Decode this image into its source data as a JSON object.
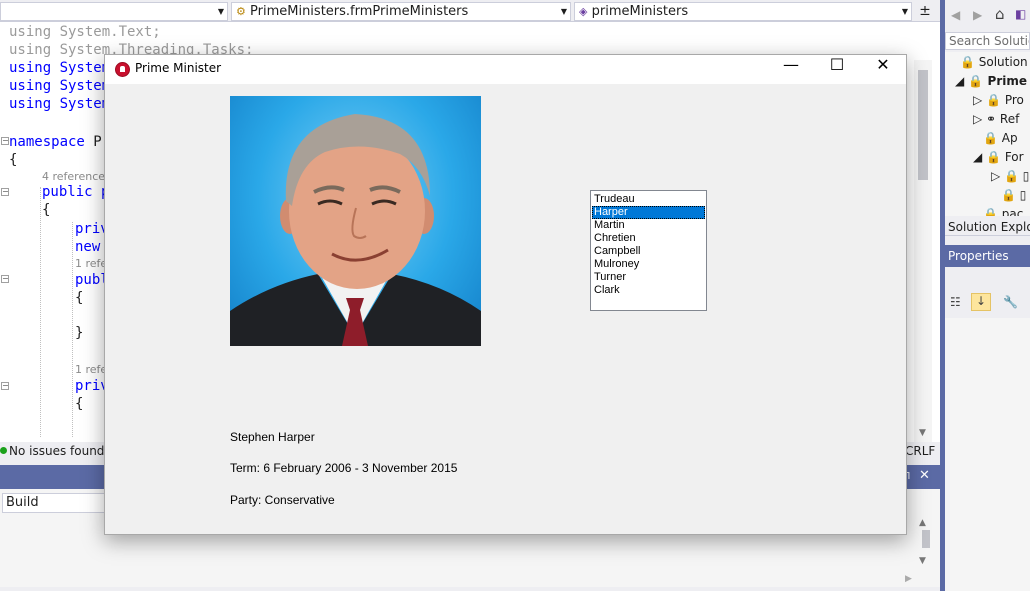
{
  "nav": {
    "project_combo": "PrimeMinisters.frmPrimeMinisters",
    "member_combo": "primeMinisters"
  },
  "code": {
    "lines": [
      "using System.Text;",
      "using System.Threading.Tasks;",
      "using System",
      "using System",
      "using System"
    ],
    "namespace_kw": "namespace",
    "namespace_name": "Pr",
    "open_brace": "{",
    "refs_4": "4 references",
    "public_kw": "public",
    "class_p": "p",
    "brace_1": "{",
    "priv_1": "priv",
    "new_kw": "new",
    "ref_1": "1 refe",
    "publ": "publ",
    "brace_2": "{",
    "brace_3": "}",
    "ref_2": "1 refe",
    "priv_2": "priv",
    "brace_4": "{"
  },
  "status": {
    "issues": "No issues found",
    "line_ending": "CRLF"
  },
  "output": {
    "source": "Build"
  },
  "solution_explorer": {
    "search_placeholder": "Search Solution",
    "items": [
      "Solution '",
      "Prime",
      "Pro",
      "Ref",
      "Ap",
      "For",
      "",
      "",
      "pac"
    ],
    "tab_label": "Solution Explor"
  },
  "properties": {
    "header": "Properties"
  },
  "dialog": {
    "title": "Prime Minister",
    "minimize": "—",
    "maximize": "☐",
    "close": "✕",
    "list_items": [
      "Trudeau",
      "Harper",
      "Martin",
      "Chretien",
      "Campbell",
      "Mulroney",
      "Turner",
      "Clark"
    ],
    "selected_index": 1,
    "name": "Stephen Harper",
    "term": "Term: 6 February 2006 - 3 November 2015",
    "party": "Party: Conservative"
  }
}
